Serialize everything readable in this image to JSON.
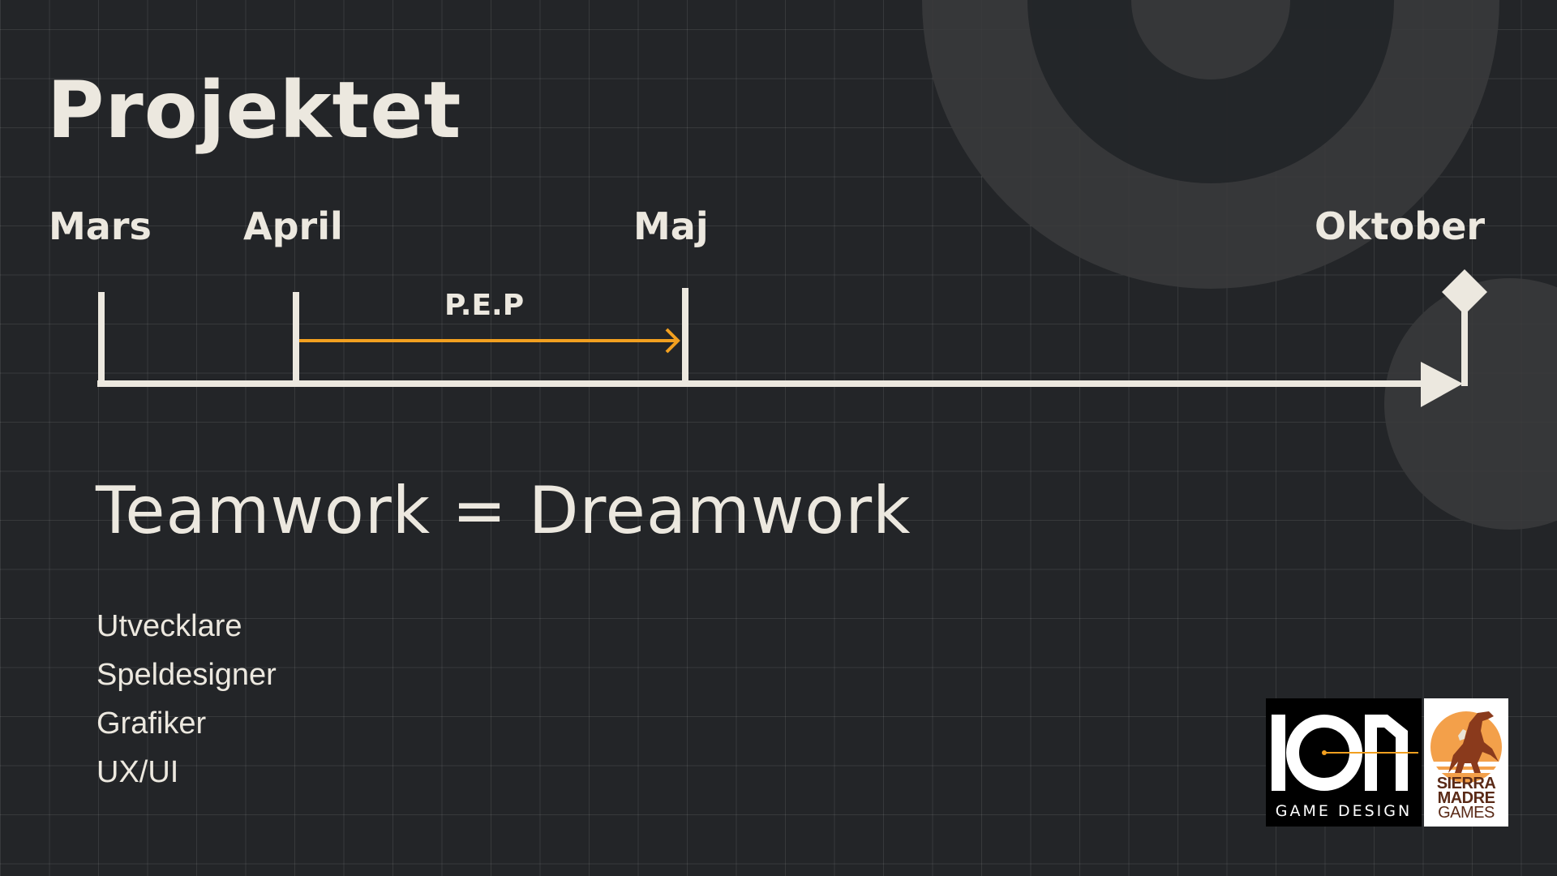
{
  "slide": {
    "title": "Projektet",
    "timeline": {
      "months": [
        "Mars",
        "April",
        "Maj",
        "Oktober"
      ],
      "phase_label": "P.E.P"
    },
    "motto": "Teamwork = Dreamwork",
    "roles": [
      "Utvecklare",
      "Speldesigner",
      "Grafiker",
      "UX/UI"
    ],
    "logos": {
      "ion_caption": "GAME DESIGN",
      "sierra_line1": "SIERRA",
      "sierra_line2": "MADRE",
      "sierra_line3": "GAMES"
    }
  },
  "colors": {
    "background": "#232528",
    "text": "#ece8df",
    "accent": "#f2a020",
    "deco_circle": "#3a3b3c"
  },
  "icons": [
    "milestone-diamond-icon",
    "arrowhead-icon",
    "ion-logo",
    "sierra-madre-logo"
  ]
}
